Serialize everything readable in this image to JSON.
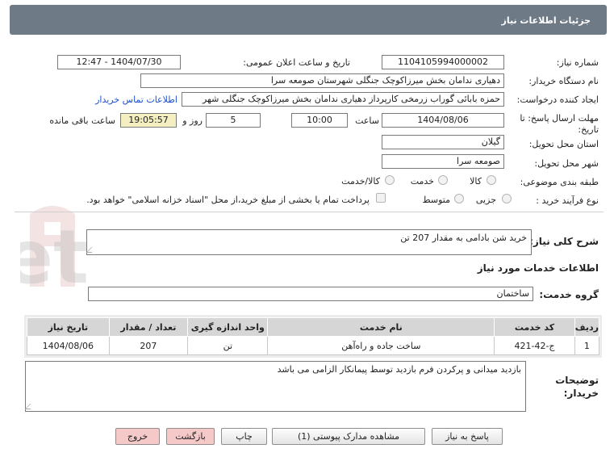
{
  "header": {
    "title": "جزئیات اطلاعات نیاز"
  },
  "form": {
    "need_number_label": "شماره نیاز:",
    "need_number": "1104105994000002",
    "announce_label": "تاریخ و ساعت اعلان عمومی:",
    "announce_value": "1404/07/30 - 12:47",
    "buyer_org_label": "نام دستگاه خریدار:",
    "buyer_org": "دهیاری ندامان بخش میرزاکوچک جنگلی شهرستان صومعه سرا",
    "creator_label": "ایجاد کننده درخواست:",
    "creator": "حمزه بابائی گوراب زرمخی کارپرداز دهیاری ندامان بخش میرزاکوچک جنگلی شهر",
    "contact_link": "اطلاعات تماس خریدار",
    "deadline_label": "مهلت ارسال پاسخ: تا تاریخ:",
    "deadline_date": "1404/08/06",
    "time_label": "ساعت",
    "deadline_time": "10:00",
    "days_value": "5",
    "days_label": "روز و",
    "remaining_time": "19:05:57",
    "remaining_label": "ساعت باقی مانده",
    "province_label": "استان محل تحویل:",
    "province": "گیلان",
    "city_label": "شهر محل تحویل:",
    "city": "صومعه سرا",
    "category_label": "طبقه بندی موضوعی:",
    "category_options": [
      "کالا",
      "خدمت",
      "کالا/خدمت"
    ],
    "purchase_type_label": "نوع فرآیند خرید :",
    "purchase_options": [
      "جزیی",
      "متوسط"
    ],
    "payment_note": "پرداخت تمام یا بخشی از مبلغ خرید،از محل \"اسناد خزانه اسلامی\" خواهد بود."
  },
  "summary": {
    "label": "شرح کلی نیاز:",
    "text": "خرید شن بادامی به مقدار 207 تن"
  },
  "services_section": {
    "title": "اطلاعات خدمات مورد نیاز",
    "group_label": "گروه خدمت:",
    "group_value": "ساختمان"
  },
  "table": {
    "headers": [
      "ردیف",
      "کد خدمت",
      "نام خدمت",
      "واحد اندازه گیری",
      "تعداد / مقدار",
      "تاریخ نیاز"
    ],
    "rows": [
      [
        "1",
        "ج-42-421",
        "ساخت جاده و راه‌آهن",
        "تن",
        "207",
        "1404/08/06"
      ]
    ]
  },
  "buyer_notes": {
    "label_line1": "توضیحات",
    "label_line2": "خریدار:",
    "text": "بازدید میدانی و پرکردن فرم بازدید توسط پیمانکار الزامی می باشد"
  },
  "buttons": {
    "reply": "پاسخ به نیاز",
    "attachments": "مشاهده مدارک پیوستی (1)",
    "print": "چاپ",
    "back": "بازگشت",
    "exit": "خروج"
  },
  "watermark": {
    "text": "AriaTender.net"
  },
  "colors": {
    "header_bg": "#6f7a87",
    "link": "#1a4fd0",
    "remaining_bg": "#f4efc0",
    "button_pink": "#f6c9c9"
  }
}
